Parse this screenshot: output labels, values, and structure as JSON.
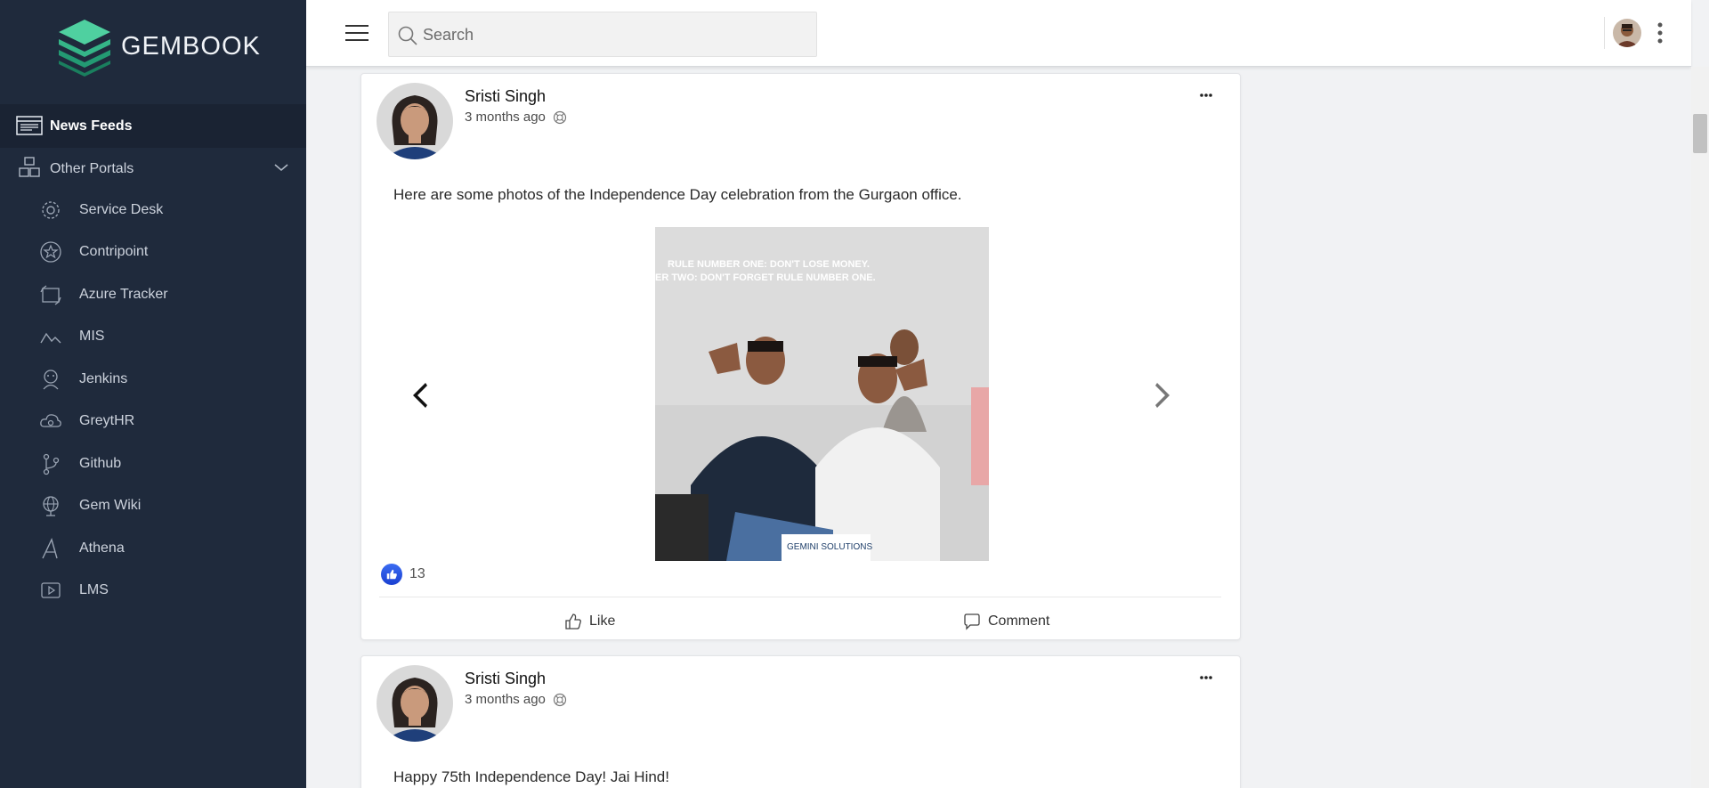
{
  "app": {
    "brand": "GEMBOOK"
  },
  "sidebar": {
    "active_item": {
      "label": "News Feeds",
      "icon": "news-feed-icon"
    },
    "group": {
      "label": "Other Portals",
      "icon": "portals-icon",
      "expanded": true
    },
    "items": [
      {
        "label": "Service Desk",
        "icon": "gear-icon"
      },
      {
        "label": "Contripoint",
        "icon": "star-icon"
      },
      {
        "label": "Azure Tracker",
        "icon": "tracker-icon"
      },
      {
        "label": "MIS",
        "icon": "chart-icon"
      },
      {
        "label": "Jenkins",
        "icon": "jenkins-icon"
      },
      {
        "label": "GreytHR",
        "icon": "cloud-icon"
      },
      {
        "label": "Github",
        "icon": "branch-icon"
      },
      {
        "label": "Gem Wiki",
        "icon": "globe-icon"
      },
      {
        "label": "Athena",
        "icon": "athena-icon"
      },
      {
        "label": "LMS",
        "icon": "video-icon"
      }
    ]
  },
  "header": {
    "search": {
      "placeholder": "Search",
      "value": ""
    }
  },
  "posts": [
    {
      "author": "Sristi Singh",
      "time": "3 months ago",
      "text": "Here are some photos of the Independence Day celebration from the Gurgaon office.",
      "photo_wall_text": [
        "RULE NUMBER ONE: DON'T LOSE MONEY.",
        "ER TWO: DON'T FORGET RULE NUMBER ONE."
      ],
      "photo_logo_text": "GEMINI SOLUTIONS",
      "like_count": "13",
      "actions": {
        "like": "Like",
        "comment": "Comment"
      }
    },
    {
      "author": "Sristi Singh",
      "time": "3 months ago",
      "text": "Happy 75th Independence Day! Jai Hind!"
    }
  ],
  "colors": {
    "sidebar_bg": "#1f2a3c",
    "sidebar_active_bg": "#1a2333",
    "brand_green": "#3fbf8f",
    "like_blue": "#2d5be3"
  }
}
